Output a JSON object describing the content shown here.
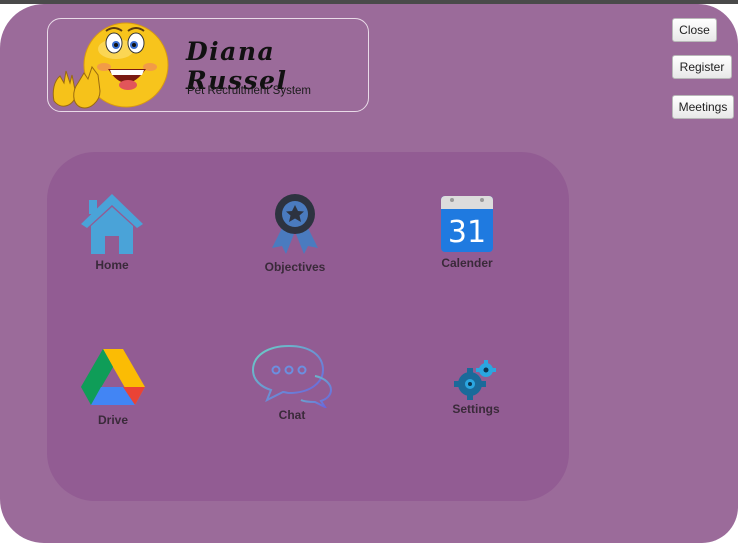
{
  "header": {
    "name": "Diana Russel",
    "subtitle": "Pet Recruitment System",
    "avatar_icon": "clapping-emoji-icon"
  },
  "side_buttons": {
    "close": "Close",
    "register": "Register",
    "meetings": "Meetings"
  },
  "menu": {
    "home": {
      "label": "Home",
      "icon": "home-icon"
    },
    "objectives": {
      "label": "Objectives",
      "icon": "award-ribbon-icon"
    },
    "calendar": {
      "label": "Calender",
      "icon": "calendar-icon",
      "day": "31"
    },
    "drive": {
      "label": "Drive",
      "icon": "google-drive-icon"
    },
    "chat": {
      "label": "Chat",
      "icon": "chat-bubbles-icon"
    },
    "settings": {
      "label": "Settings",
      "icon": "gears-icon"
    }
  },
  "colors": {
    "window_bg": "#9b6b9a",
    "panel_bg": "#925c93",
    "home_icon": "#4aa3d8",
    "objectives_icon": "#2d3340"
  }
}
